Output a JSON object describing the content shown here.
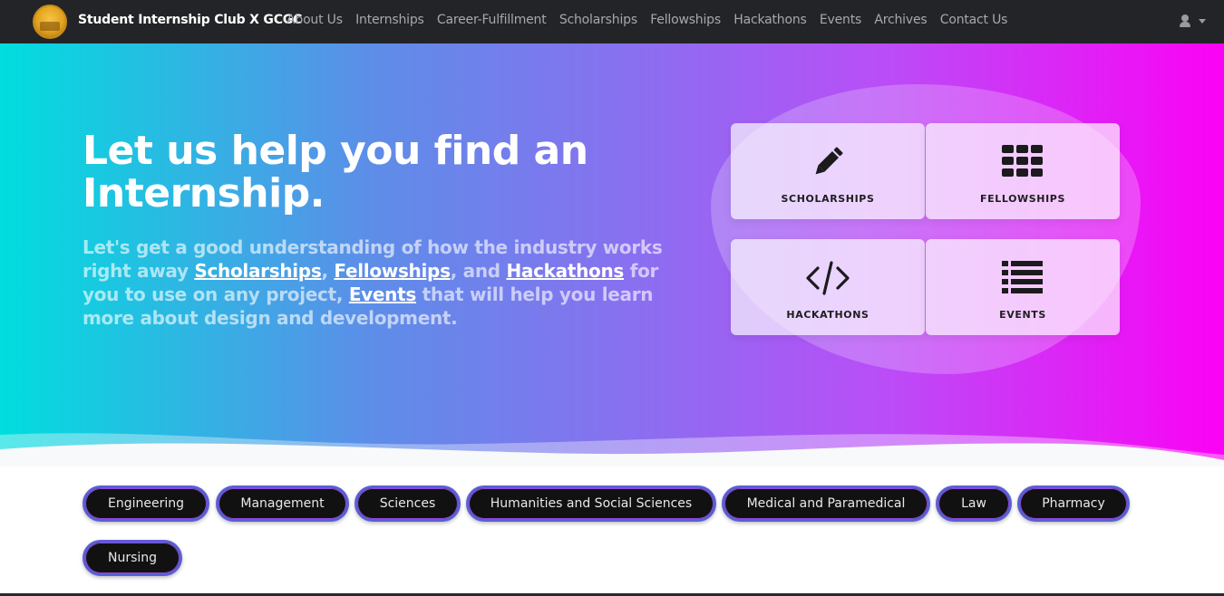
{
  "nav": {
    "brand": "Student Internship Club X GCGC",
    "links": [
      "About Us",
      "Internships",
      "Career-Fulfillment",
      "Scholarships",
      "Fellowships",
      "Hackathons",
      "Events",
      "Archives",
      "Contact Us"
    ]
  },
  "hero": {
    "title": "Let us help you find an Internship.",
    "desc_parts": {
      "p1": "Let's get a good understanding of how the industry works right away ",
      "l1": "Scholarships",
      "p2": ", ",
      "l2": "Fellowships",
      "p3": ", and ",
      "l3": "Hackathons",
      "p4": " for you to use on any project, ",
      "l4": "Events",
      "p5": " that will help you learn more about design and development."
    },
    "cards": [
      {
        "label": "SCHOLARSHIPS",
        "icon": "pencil-icon"
      },
      {
        "label": "FELLOWSHIPS",
        "icon": "grid-icon"
      },
      {
        "label": "HACKATHONS",
        "icon": "code-icon"
      },
      {
        "label": "EVENTS",
        "icon": "list-icon"
      }
    ]
  },
  "categories": [
    "Engineering",
    "Management",
    "Sciences",
    "Humanities and Social Sciences",
    "Medical and Paramedical",
    "Law",
    "Pharmacy",
    "Nursing"
  ],
  "colors": {
    "nav_bg": "#232427",
    "hero_gradient_start": "#00dede",
    "hero_gradient_end": "#fb02f5",
    "chip_bg": "#111111",
    "chip_border": "#5a5fd6"
  }
}
